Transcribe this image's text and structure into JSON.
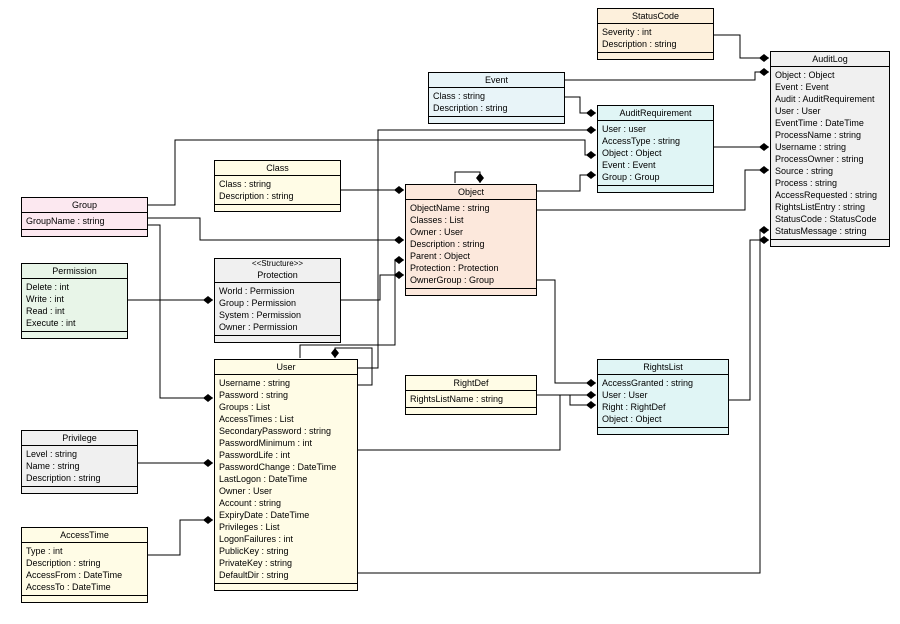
{
  "classes": {
    "statuscode": {
      "title": "StatusCode",
      "stereotype": null,
      "attrs": [
        "Severity : int",
        "Description : string"
      ]
    },
    "auditlog": {
      "title": "AuditLog",
      "stereotype": null,
      "attrs": [
        "Object : Object",
        "Event : Event",
        "Audit : AuditRequirement",
        "User : User",
        "EventTime : DateTime",
        "ProcessName : string",
        "Username : string",
        "ProcessOwner : string",
        "Source : string",
        "Process : string",
        "AccessRequested : string",
        "RightsListEntry : string",
        "StatusCode : StatusCode",
        "StatusMessage : string"
      ]
    },
    "event": {
      "title": "Event",
      "stereotype": null,
      "attrs": [
        "Class : string",
        "Description : string"
      ]
    },
    "auditreq": {
      "title": "AuditRequirement",
      "stereotype": null,
      "attrs": [
        "User : user",
        "AccessType : string",
        "Object : Object",
        "Event : Event",
        "Group : Group"
      ]
    },
    "class": {
      "title": "Class",
      "stereotype": null,
      "attrs": [
        "Class : string",
        "Description : string"
      ]
    },
    "object": {
      "title": "Object",
      "stereotype": null,
      "attrs": [
        "ObjectName : string",
        "Classes : List",
        "Owner : User",
        "Description : string",
        "Parent : Object",
        "Protection : Protection",
        "OwnerGroup : Group"
      ]
    },
    "group": {
      "title": "Group",
      "stereotype": null,
      "attrs": [
        "GroupName : string"
      ]
    },
    "permission": {
      "title": "Permission",
      "stereotype": null,
      "attrs": [
        "Delete : int",
        "Write : int",
        "Read : int",
        "Execute : int"
      ]
    },
    "protection": {
      "title": "Protection",
      "stereotype": "<<Structure>>",
      "attrs": [
        "World : Permission",
        "Group : Permission",
        "System : Permission",
        "Owner : Permission"
      ]
    },
    "user": {
      "title": "User",
      "stereotype": null,
      "attrs": [
        "Username : string",
        "Password : string",
        "Groups : List",
        "AccessTimes : List",
        "SecondaryPassword : string",
        "PasswordMinimum : int",
        "PasswordLife : int",
        "PasswordChange : DateTime",
        "LastLogon : DateTime",
        "Owner : User",
        "Account : string",
        "ExpiryDate : DateTime",
        "Privileges : List",
        "LogonFailures : int",
        "PublicKey : string",
        "PrivateKey : string",
        "DefaultDir : string"
      ]
    },
    "rightdef": {
      "title": "RightDef",
      "stereotype": null,
      "attrs": [
        "RightsListName : string"
      ]
    },
    "rightslist": {
      "title": "RightsList",
      "stereotype": null,
      "attrs": [
        "AccessGranted : string",
        "User : User",
        "Right : RightDef",
        "Object : Object"
      ]
    },
    "privilege": {
      "title": "Privilege",
      "stereotype": null,
      "attrs": [
        "Level : string",
        "Name : string",
        "Description : string"
      ]
    },
    "accesstime": {
      "title": "AccessTime",
      "stereotype": null,
      "attrs": [
        "Type : int",
        "Description : string",
        "AccessFrom : DateTime",
        "AccessTo : DateTime"
      ]
    }
  },
  "colors": {
    "yellow": "#fffce6",
    "blue": "#e8f4f8",
    "pink": "#fce8f0",
    "cyan": "#e0f5f5",
    "green": "#e8f5e8",
    "grey": "#f0f0f0",
    "orange": "#fdf0dc",
    "peach": "#fce8dc"
  }
}
